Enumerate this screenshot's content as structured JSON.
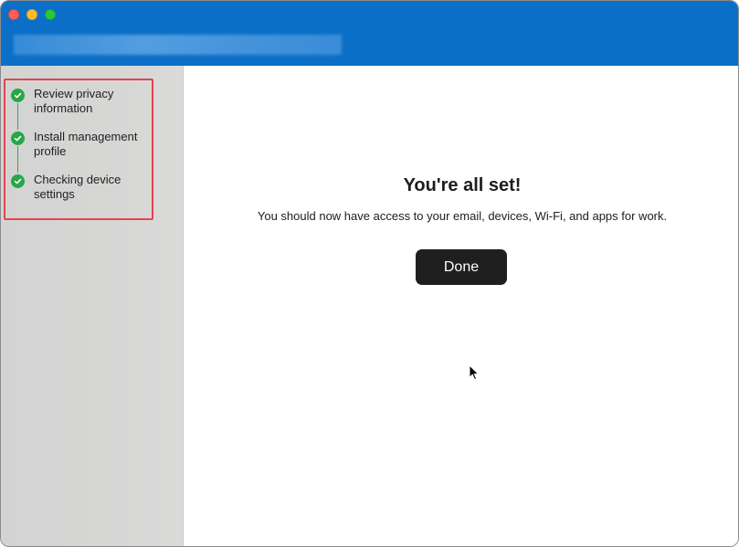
{
  "window": {
    "title_bar_color": "#0b6fc7"
  },
  "sidebar": {
    "steps": [
      {
        "label": "Review privacy information",
        "status": "complete"
      },
      {
        "label": "Install management profile",
        "status": "complete"
      },
      {
        "label": "Checking device settings",
        "status": "complete"
      }
    ]
  },
  "main": {
    "headline": "You're all set!",
    "message": "You should now have access to your email, devices, Wi-Fi, and apps for work.",
    "done_label": "Done"
  },
  "colors": {
    "accent_green": "#28a745",
    "highlight_red": "#e0464f",
    "button_dark": "#1f1f1f"
  }
}
